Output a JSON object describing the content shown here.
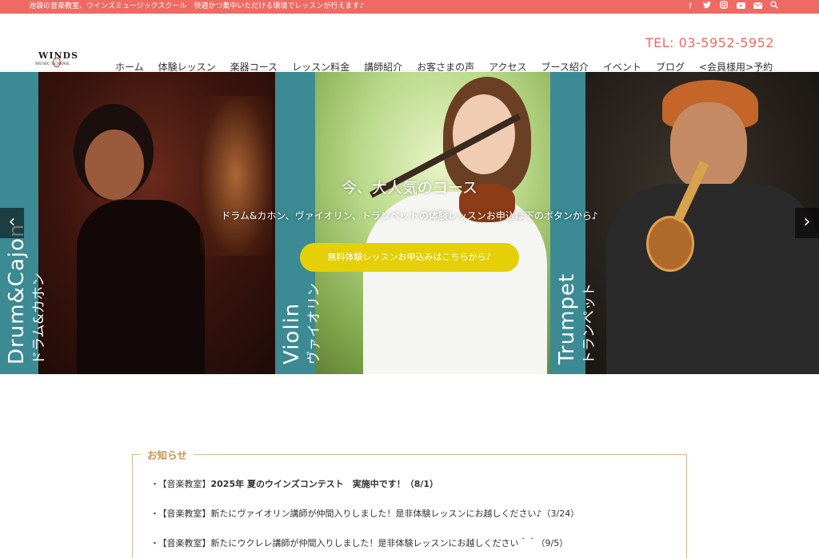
{
  "topbar": {
    "text": "池袋の音楽教室、ウインズミュージックスクール　快適かつ集中いただける環境でレッスンが行えます♪",
    "icons": [
      "facebook-icon",
      "twitter-icon",
      "instagram-icon",
      "youtube-icon",
      "mail-icon",
      "search-icon"
    ]
  },
  "header": {
    "logo_main": "WINDS",
    "logo_sub": "MUSIC  SCHOOL",
    "tel": "TEL: 03-5952-5952"
  },
  "nav": {
    "items": [
      "ホーム",
      "体験レッスン",
      "楽器コース",
      "レッスン料金",
      "講師紹介",
      "お客さまの声",
      "アクセス",
      "ブース紹介",
      "イベント",
      "ブログ",
      "<会員様用>予約"
    ]
  },
  "hero": {
    "panels": [
      {
        "en": "Drum&Cajon",
        "ja": "ドラム&カホン"
      },
      {
        "en": "Violin",
        "ja": "ヴァイオリン"
      },
      {
        "en": "Trumpet",
        "ja": "トランペット"
      }
    ],
    "title": "今、大人気のコース",
    "subtitle": "ドラム&カホン、ヴァイオリン、トランペットの体験レッスンお申込は下のボタンから♪",
    "cta": "無料体験レッスンお申込みはこちらから♪",
    "prev": "‹",
    "next": "›"
  },
  "news": {
    "heading": "お知らせ",
    "items": [
      {
        "tag": "【音楽教室】",
        "text": "2025年 夏のウインズコンテスト　実施中です！（8/1）"
      },
      {
        "tag": "【音楽教室】",
        "text": "新たにヴァイオリン講師が仲間入りしました！是非体験レッスンにお越しください♪（3/24）"
      },
      {
        "tag": "【音楽教室】",
        "text": "新たにウクレレ講師が仲間入りしました！是非体験レッスンにお越しください＾＾（9/5）"
      }
    ]
  },
  "colors": {
    "accent": "#ef6a63",
    "teal_strip": "#3c8a93",
    "cta": "#e5cf06",
    "news_border": "#d9b98a"
  }
}
